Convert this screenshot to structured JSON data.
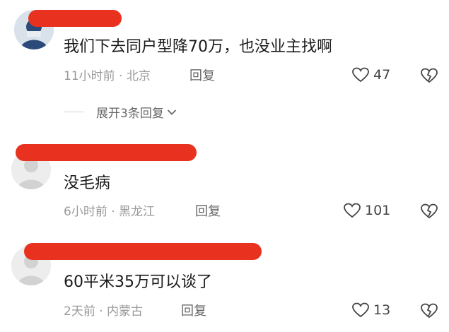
{
  "comments": [
    {
      "text": "我们下去同户型降70万，也没业主找啊",
      "time": "11小时前",
      "location": "北京",
      "reply_label": "回复",
      "likes": "47",
      "expand_label": "展开3条回复"
    },
    {
      "text": "没毛病",
      "time": "6小时前",
      "location": "黑龙江",
      "reply_label": "回复",
      "likes": "101"
    },
    {
      "text": "60平米35万可以谈了",
      "time": "2天前",
      "location": "内蒙古",
      "reply_label": "回复",
      "likes": "13"
    }
  ],
  "separator": " · ",
  "colors": {
    "redaction": "#e8311f",
    "meta": "#9a9a9a",
    "text": "#1a1a1a"
  },
  "icons": [
    "heart-outline-icon",
    "broken-heart-icon",
    "chevron-down-icon",
    "avatar-placeholder-icon"
  ]
}
